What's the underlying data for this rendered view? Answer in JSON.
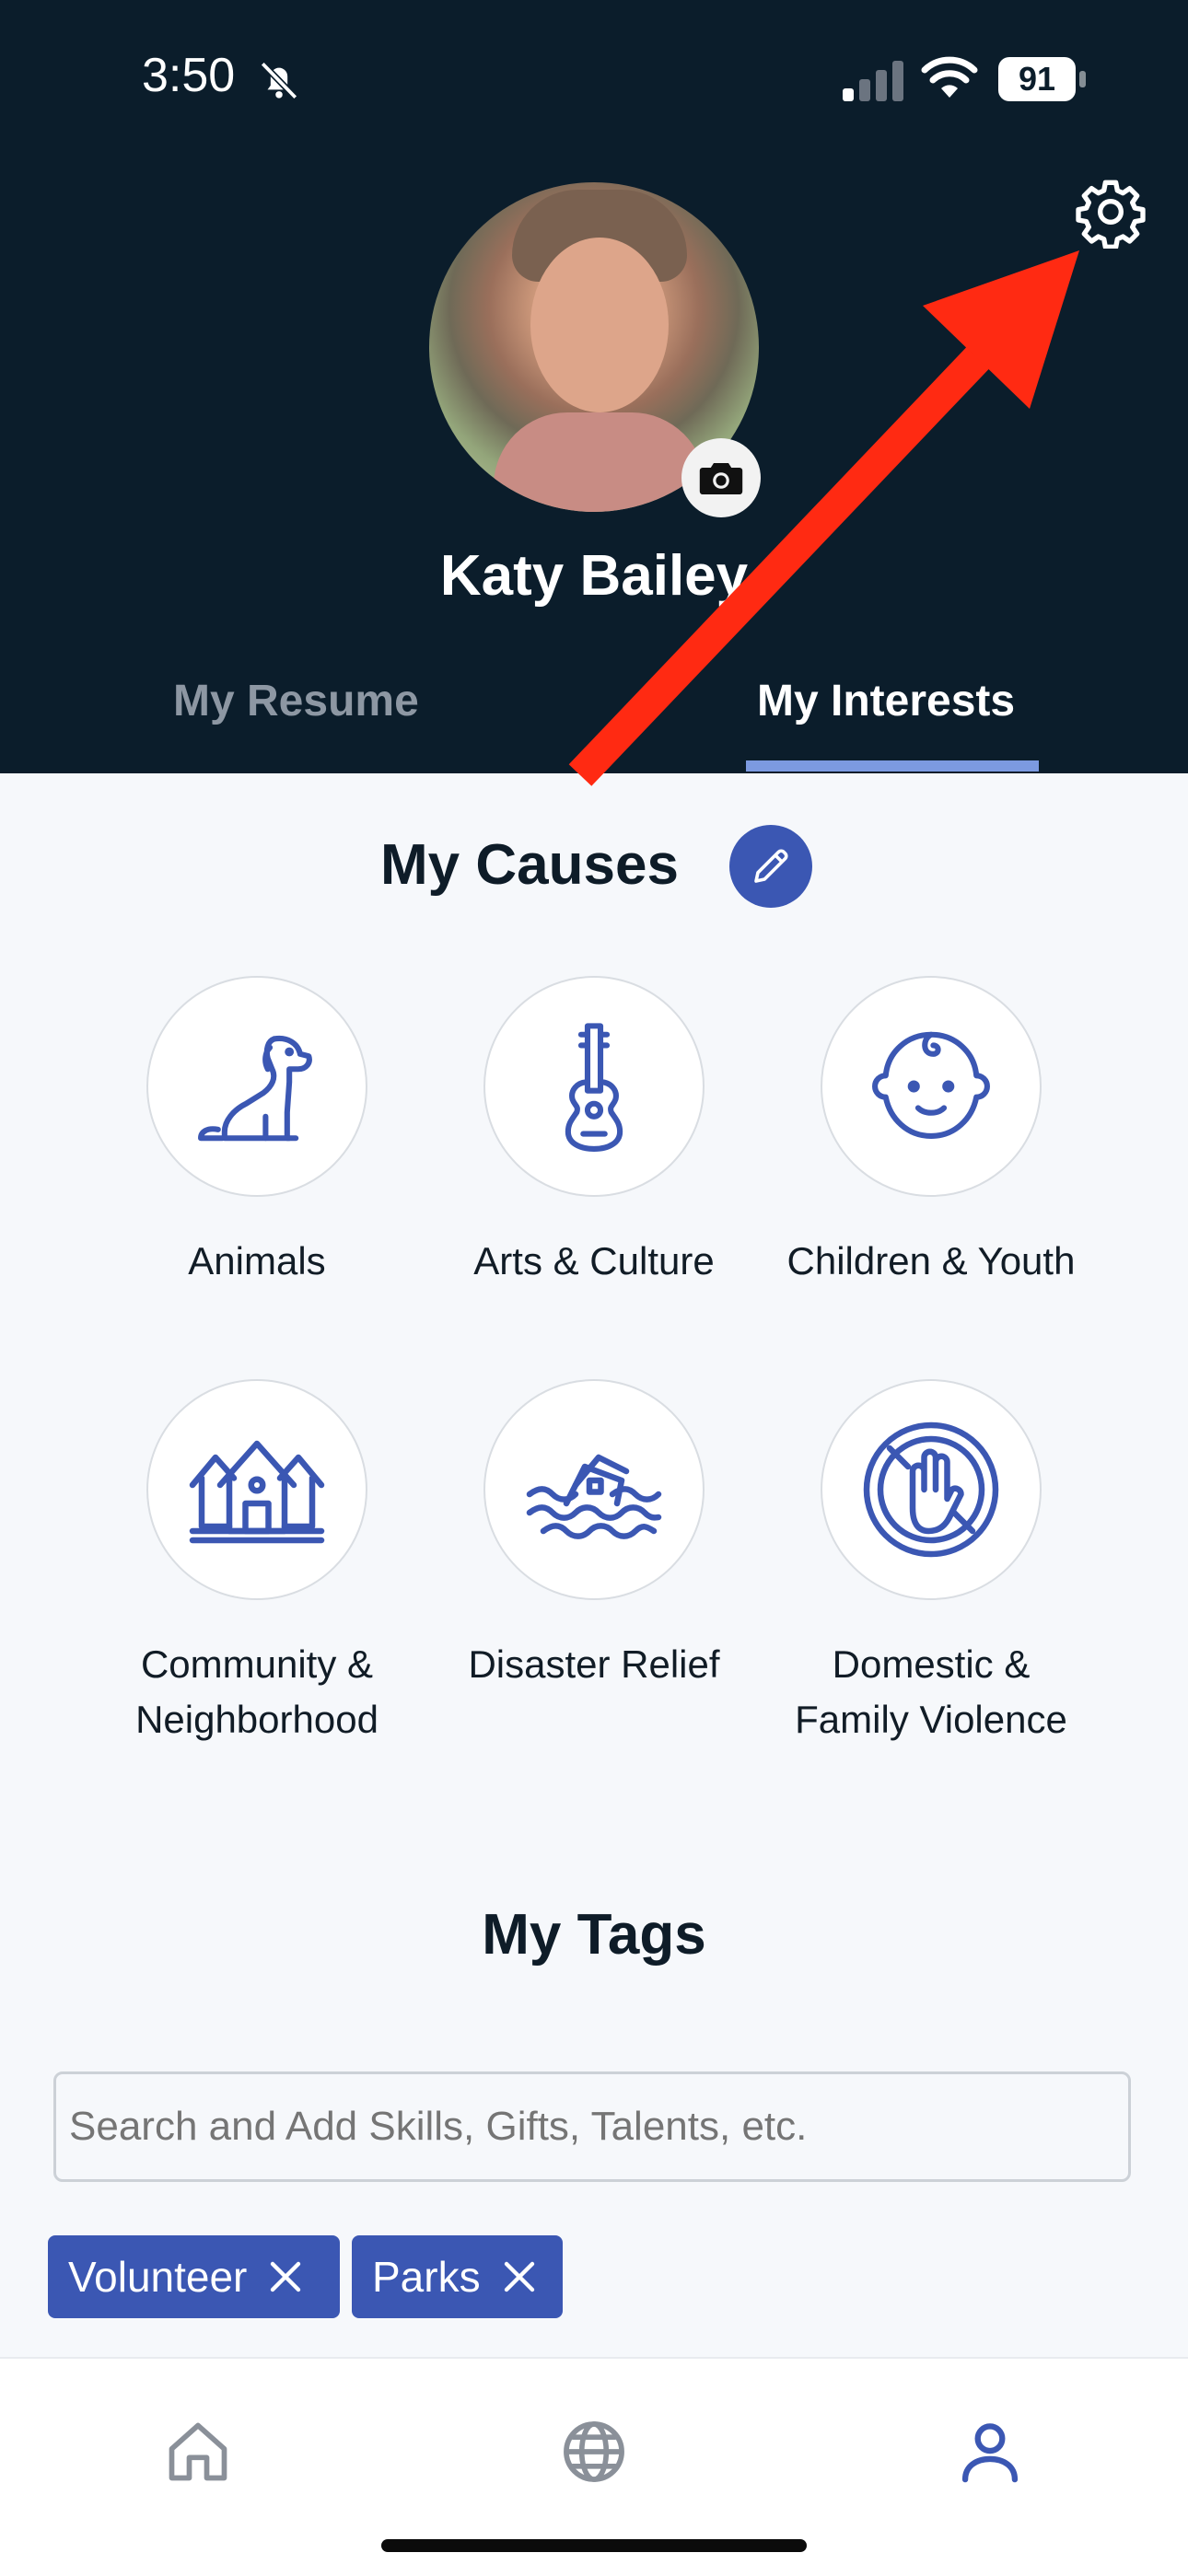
{
  "status_bar": {
    "time": "3:50",
    "battery": "91",
    "icons": [
      "bell-slash-icon",
      "signal-icon",
      "wifi-icon",
      "battery-icon"
    ]
  },
  "profile": {
    "name": "Katy Bailey",
    "settings_icon": "gear-icon",
    "camera_icon": "camera-icon"
  },
  "tabs": [
    {
      "label": "My Resume",
      "active": false
    },
    {
      "label": "My Interests",
      "active": true
    }
  ],
  "causes": {
    "title": "My Causes",
    "edit_icon": "pencil-icon",
    "items": [
      {
        "label": "Animals",
        "icon": "dog-icon"
      },
      {
        "label": "Arts & Culture",
        "icon": "guitar-icon"
      },
      {
        "label": "Children & Youth",
        "icon": "baby-face-icon"
      },
      {
        "label": "Community & Neighborhood",
        "icon": "houses-icon"
      },
      {
        "label": "Disaster Relief",
        "icon": "flooded-house-icon"
      },
      {
        "label": "Domestic & Family Violence",
        "icon": "stop-hand-icon"
      }
    ]
  },
  "tags": {
    "title": "My Tags",
    "search_placeholder": "Search and Add Skills, Gifts, Talents, etc.",
    "items": [
      "Volunteer",
      "Parks"
    ]
  },
  "bottom_nav": [
    "home-icon",
    "globe-icon",
    "user-icon"
  ],
  "colors": {
    "header_bg": "#0b1d2b",
    "accent": "#3b57b3",
    "annotation_arrow": "#ff2a12"
  }
}
